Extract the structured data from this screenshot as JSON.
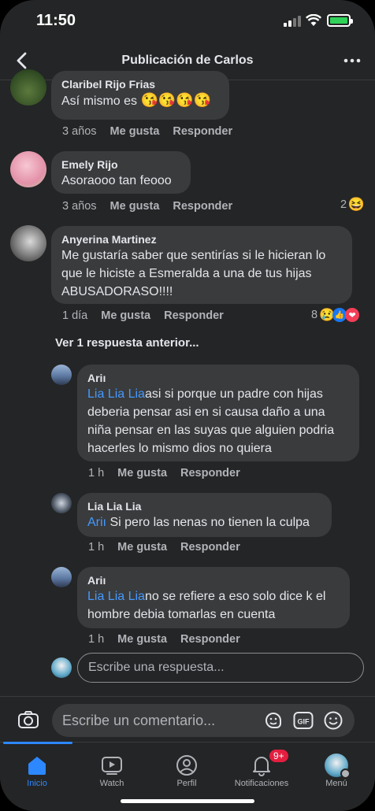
{
  "status_bar": {
    "time": "11:50"
  },
  "header": {
    "title": "Publicación de Carlos"
  },
  "comments": [
    {
      "name": "Claribel Rijo Frias",
      "text": "Así mismo  es",
      "emoji": "😘😘😘😘",
      "time": "3 años",
      "like": "Me gusta",
      "reply": "Responder"
    },
    {
      "name": "Emely Rijo",
      "text": "Asoraooo tan feooo",
      "time": "3 años",
      "like": "Me gusta",
      "reply": "Responder",
      "reaction_count": "2",
      "reactions": [
        "😆"
      ]
    },
    {
      "name": "Anyerina Martinez",
      "text": "Me gustaría saber que sentirías si le hicieran lo que le hiciste a Esmeralda a una de tus hijas ABUSADORASO!!!!",
      "time": "1 día",
      "like": "Me gusta",
      "reply": "Responder",
      "reaction_count": "8",
      "reactions": [
        "😢",
        "👍",
        "❤"
      ]
    }
  ],
  "more_replies_label": "Ver 1 respuesta anterior...",
  "replies": [
    {
      "name": "Ariı",
      "mention": "Lia Lia Lia",
      "text": "asi si porque un padre con hijas deberia pensar asi en si causa daño a una niña pensar en las suyas que alguien podria hacerles lo mismo dios no quiera",
      "time": "1 h",
      "like": "Me gusta",
      "reply": "Responder"
    },
    {
      "name": "Lia Lia Lia",
      "mention": "Ariı",
      "text": " Si pero las nenas no tienen la culpa",
      "time": "1 h",
      "like": "Me gusta",
      "reply": "Responder"
    },
    {
      "name": "Ariı",
      "mention": "Lia Lia Lia",
      "text": "no se refiere a eso solo dice k el hombre debia tomarlas en cuenta",
      "time": "1 h",
      "like": "Me gusta",
      "reply": "Responder"
    }
  ],
  "reply_input": {
    "placeholder": "Escribe una respuesta..."
  },
  "comment_input": {
    "placeholder": "Escribe un comentario..."
  },
  "composer_icons": [
    "camera-icon",
    "sticker-icon",
    "gif-icon",
    "emoji-icon"
  ],
  "gif_label": "GIF",
  "tabs": [
    {
      "label": "Inicio",
      "icon": "home-icon",
      "active": true
    },
    {
      "label": "Watch",
      "icon": "watch-icon"
    },
    {
      "label": "Perfil",
      "icon": "profile-icon"
    },
    {
      "label": "Notificaciones",
      "icon": "bell-icon",
      "badge": "9+"
    },
    {
      "label": "Menú",
      "icon": "menu-avatar-icon"
    }
  ],
  "colors": {
    "background": "#242526",
    "bubble": "#3a3b3c",
    "accent": "#2d88ff",
    "mention": "#4599ff",
    "badge": "#e41e3f"
  }
}
